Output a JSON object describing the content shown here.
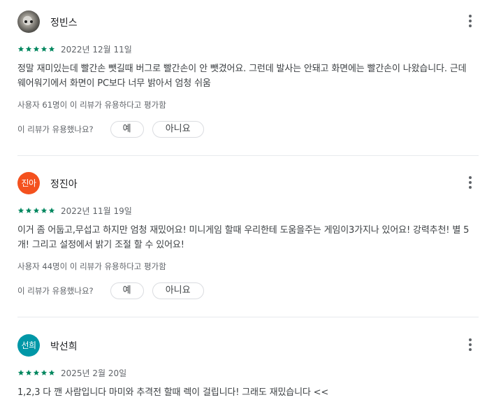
{
  "reviews": [
    {
      "author": "정빈스",
      "avatar_initials": "",
      "avatar_color": "#6e6b66",
      "rating": 5,
      "date": "2022년 12월 11일",
      "text": "정말 재미있는데 빨간손 뺏길때 버그로 빨간손이 안 뺏겼어요. 그런데 발사는 안돼고 화면에는 빨간손이 나왔습니다. 근데 웨어워기에서 화면이 PC보다 너무 밝아서 엄청 쉬움",
      "helpful_count": "사용자 61명이 이 리뷰가 유용하다고 평가함",
      "helpful_question": "이 리뷰가 유용했나요?",
      "yes_label": "예",
      "no_label": "아니요"
    },
    {
      "author": "정진아",
      "avatar_initials": "진아",
      "avatar_color": "#f4511e",
      "rating": 5,
      "date": "2022년 11월 19일",
      "text": "이거 좀 어둡고,무섭고 하지만 엄청 재밌어요! 미니게임 할때 우리한테 도움을주는 게임이3가지나 있어요! 강력추천! 별 5개! 그리고 설정에서 밝기 조절 할 수 있어요!",
      "helpful_count": "사용자 44명이 이 리뷰가 유용하다고 평가함",
      "helpful_question": "이 리뷰가 유용했나요?",
      "yes_label": "예",
      "no_label": "아니요"
    },
    {
      "author": "박선희",
      "avatar_initials": "선희",
      "avatar_color": "#0097a7",
      "rating": 5,
      "date": "2025년 2월 20일",
      "text": "1,2,3 다 깬 사람입니다 마미와 추격전 할때 렉이 걸립니다! 그래도 재밌습니다 <<"
    }
  ],
  "colors": {
    "star": "#01875f",
    "divider": "#e8eaed",
    "secondary_text": "#5f6368"
  },
  "icons": {
    "more": "more-vert-icon",
    "star": "star-icon"
  }
}
